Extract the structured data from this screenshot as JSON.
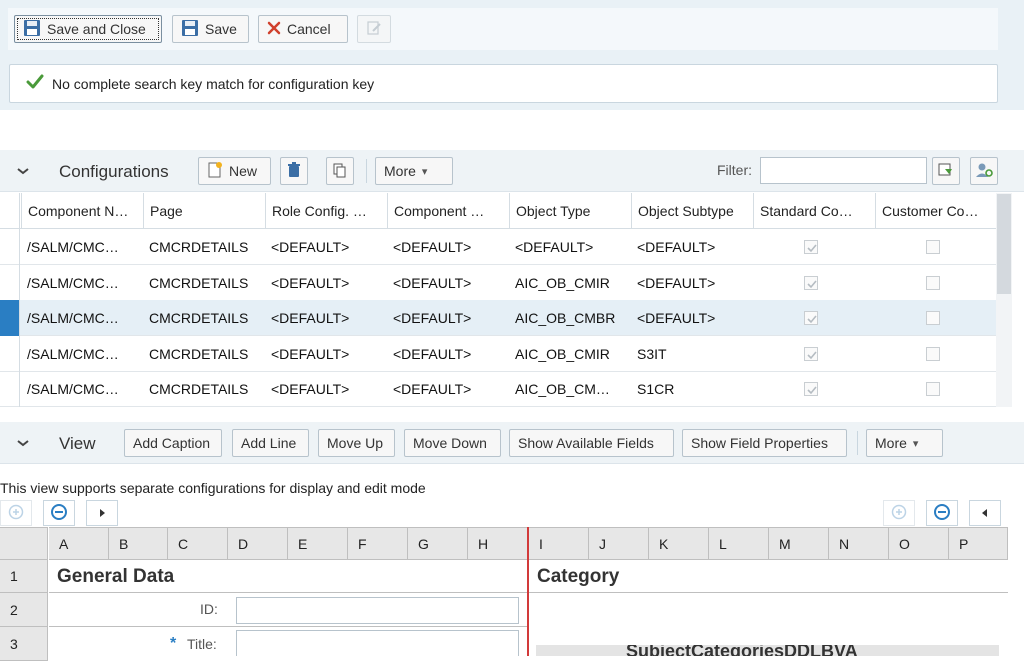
{
  "toolbar": {
    "save_close_label": "Save and Close",
    "save_label": "Save",
    "cancel_label": "Cancel"
  },
  "message": {
    "text": "No complete search key match for configuration key"
  },
  "configurations": {
    "title": "Configurations",
    "new_label": "New",
    "more_label": "More",
    "filter_label": "Filter:",
    "filter_value": "",
    "columns": [
      "Component N…",
      "Page",
      "Role Config. …",
      "Component …",
      "Object Type",
      "Object Subtype",
      "Standard Co…",
      "Customer Co…"
    ],
    "rows": [
      {
        "component": "/SALM/CMC…",
        "page": "CMCRDETAILS",
        "role": "<DEFAULT>",
        "comp": "<DEFAULT>",
        "objtype": "<DEFAULT>",
        "subtype": "<DEFAULT>",
        "standard": true,
        "customer": false
      },
      {
        "component": "/SALM/CMC…",
        "page": "CMCRDETAILS",
        "role": "<DEFAULT>",
        "comp": "<DEFAULT>",
        "objtype": "AIC_OB_CMIR",
        "subtype": "<DEFAULT>",
        "standard": true,
        "customer": false
      },
      {
        "component": "/SALM/CMC…",
        "page": "CMCRDETAILS",
        "role": "<DEFAULT>",
        "comp": "<DEFAULT>",
        "objtype": "AIC_OB_CMBR",
        "subtype": "<DEFAULT>",
        "standard": true,
        "customer": false
      },
      {
        "component": "/SALM/CMC…",
        "page": "CMCRDETAILS",
        "role": "<DEFAULT>",
        "comp": "<DEFAULT>",
        "objtype": "AIC_OB_CMIR",
        "subtype": "S3IT",
        "standard": true,
        "customer": false
      },
      {
        "component": "/SALM/CMC…",
        "page": "CMCRDETAILS",
        "role": "<DEFAULT>",
        "comp": "<DEFAULT>",
        "objtype": "AIC_OB_CM…",
        "subtype": "S1CR",
        "standard": true,
        "customer": false
      }
    ]
  },
  "view": {
    "title": "View",
    "add_caption": "Add Caption",
    "add_line": "Add Line",
    "move_up": "Move Up",
    "move_down": "Move Down",
    "show_fields": "Show Available Fields",
    "show_props": "Show Field Properties",
    "more_label": "More",
    "info": "This view supports separate configurations for display and edit mode"
  },
  "sheet": {
    "columns": [
      "A",
      "B",
      "C",
      "D",
      "E",
      "F",
      "G",
      "H",
      "I",
      "J",
      "K",
      "L",
      "M",
      "N",
      "O",
      "P"
    ],
    "rows": [
      "1",
      "2",
      "3"
    ],
    "general_data": "General Data",
    "category": "Category",
    "id_label": "ID:",
    "title_required": "*",
    "title_label": "Title:",
    "partial_text": "SubjectCategoriesDDLBVA"
  },
  "colors": {
    "accent": "#2a7ec3",
    "check_green": "#4a9a3a",
    "cancel_red": "#d0402c",
    "split_red": "#d23a3a"
  }
}
